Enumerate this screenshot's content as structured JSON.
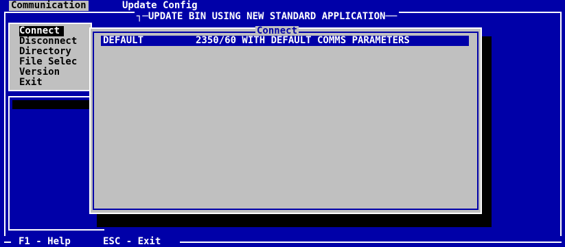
{
  "menubar": {
    "items": [
      "Communication",
      "Update Config"
    ],
    "active_index": 0
  },
  "outer": {
    "title": "UPDATE BIN USING NEW STANDARD APPLICATION"
  },
  "left_menu": {
    "items": [
      "Connect",
      "Disconnect",
      "Directory",
      "File Selec",
      "Version",
      "Exit"
    ],
    "selected": "Connect"
  },
  "dialog": {
    "title": "Connect",
    "rows": [
      {
        "name": "DEFAULT",
        "description": "2350/60 WITH DEFAULT COMMS PARAMETERS"
      }
    ]
  },
  "status": {
    "help": "F1 - Help",
    "exit": "ESC - Exit"
  },
  "colors": {
    "background": "#0000a8",
    "panel": "#c0c0c0",
    "highlight": "#0000a8",
    "text": "#ffffff"
  }
}
